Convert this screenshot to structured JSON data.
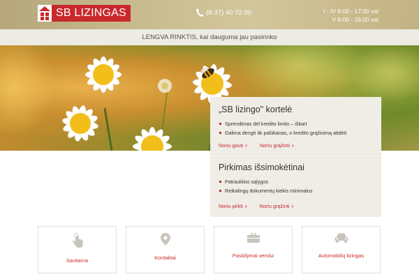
{
  "header": {
    "logo_text": "SB LIZINGAS",
    "phone": "(8-37) 40 72 00",
    "hours": [
      "I - IV 8:00 - 17:00 val",
      "V 8:00 - 16:00 val"
    ]
  },
  "tagline": "LENGVA RINKTIS, kai dauguma jau pasirinko",
  "cards": [
    {
      "title": "„SB lizingo\" kortelė",
      "bullets": [
        "Sprendimas dėl kredito limito – iškart",
        "Galima dengti tik palūkanas, o kredito grąžinimą atidėti"
      ],
      "links": [
        "Noriu gauti",
        "Noriu grąžinti"
      ]
    },
    {
      "title": "Pirkimas išsimokėtinai",
      "bullets": [
        "Patrauklios sąlygos",
        "Reikalingų dokumentų kiekis minimalus"
      ],
      "links": [
        "Noriu pirkti",
        "Noriu grąžinti"
      ]
    }
  ],
  "tiles": [
    {
      "label": "Savitarna",
      "icon": "hand-pointer-icon"
    },
    {
      "label": "Kontaktai",
      "icon": "map-pin-icon"
    },
    {
      "label": "Pasiūlymai verslui",
      "icon": "briefcase-icon"
    },
    {
      "label": "Automobilių lizingas",
      "icon": "car-icon"
    }
  ],
  "colors": {
    "brand_red": "#c9292b",
    "header_gold": "#c9bc90",
    "card_bg": "#efede6",
    "tagline_bg": "#ecebe4"
  }
}
